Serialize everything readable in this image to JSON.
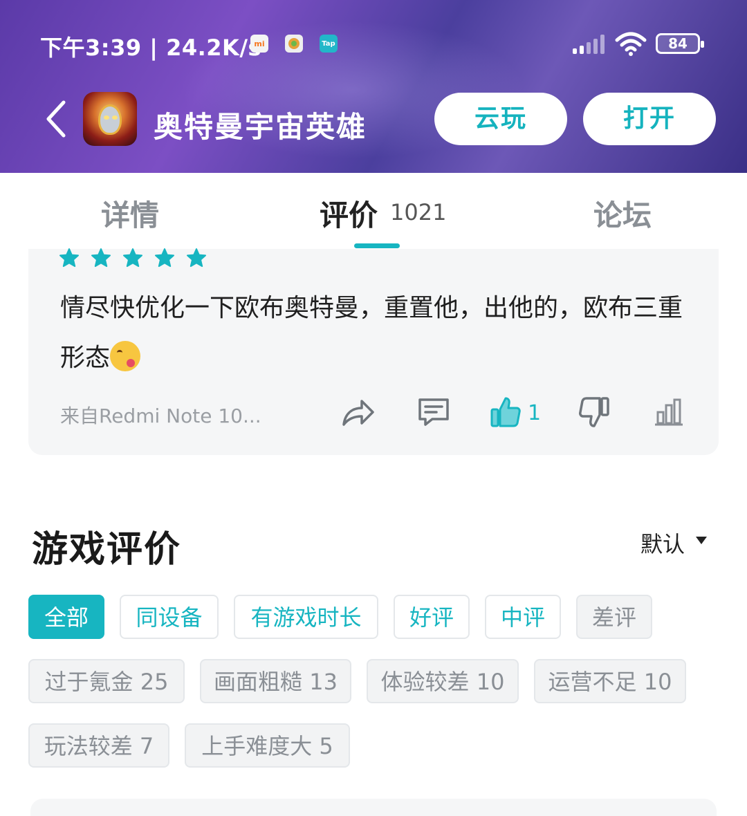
{
  "status_bar": {
    "time_speed": "下午3:39 | 24.2K/s",
    "battery": "84",
    "app_icons": [
      "mi-icon",
      "app-icon",
      "tap-icon"
    ],
    "tap_label": "Tap",
    "mi_label": "mi"
  },
  "header": {
    "title": "奥特曼宇宙英雄",
    "cloud_play_label": "云玩",
    "open_label": "打开"
  },
  "tabs": {
    "detail": "详情",
    "review": "评价",
    "review_count": "1021",
    "forum": "论坛"
  },
  "review": {
    "stars": 5,
    "text": "情尽快优化一下欧布奥特曼，重置他，出他的，欧布三重形态",
    "device": "来自Redmi Note 10...",
    "like_count": "1"
  },
  "section": {
    "title": "游戏评价",
    "sort_label": "默认"
  },
  "filters": [
    {
      "label": "全部",
      "style": "active"
    },
    {
      "label": "同设备",
      "style": "outline"
    },
    {
      "label": "有游戏时长",
      "style": "outline"
    },
    {
      "label": "好评",
      "style": "outline"
    },
    {
      "label": "中评",
      "style": "outline"
    },
    {
      "label": "差评",
      "style": "grey"
    }
  ],
  "tags": [
    {
      "label": "过于氪金 25"
    },
    {
      "label": "画面粗糙 13"
    },
    {
      "label": "体验较差 10"
    },
    {
      "label": "运营不足 10"
    },
    {
      "label": "玩法较差 7"
    },
    {
      "label": "上手难度大 5"
    }
  ],
  "colors": {
    "accent": "#17b5c1",
    "header_gradient_start": "#5b3aa8",
    "header_gradient_end": "#3a2f86"
  }
}
